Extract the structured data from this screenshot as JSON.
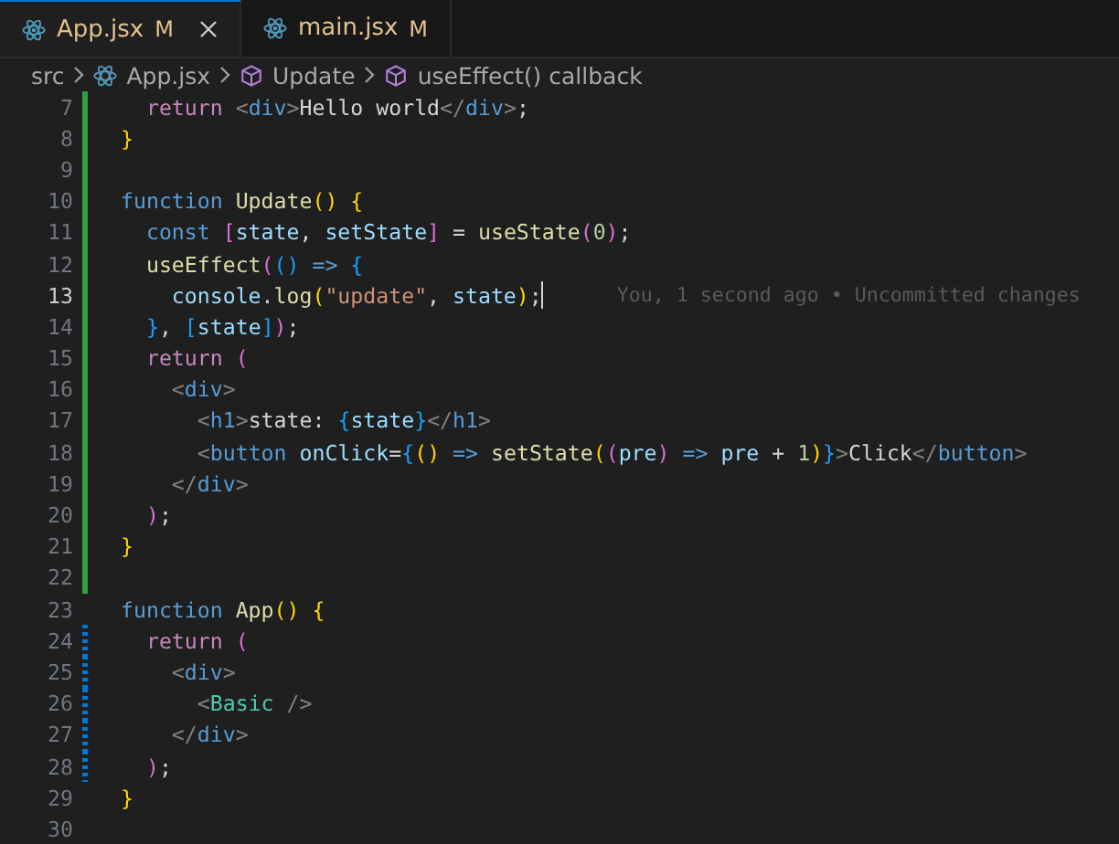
{
  "tabs": [
    {
      "label": "App.jsx",
      "status": "M",
      "selected": true
    },
    {
      "label": "main.jsx",
      "status": "M",
      "selected": false
    }
  ],
  "breadcrumb": [
    {
      "label": "src",
      "kind": "folder"
    },
    {
      "label": "App.jsx",
      "kind": "file"
    },
    {
      "label": "Update",
      "kind": "symbol"
    },
    {
      "label": "useEffect() callback",
      "kind": "symbol"
    }
  ],
  "editor": {
    "lines": [
      {
        "number": "7",
        "added": true,
        "modified": false,
        "current": false,
        "tokens": [
          {
            "t": "  return ",
            "color": "#c586c0"
          },
          {
            "t": "<",
            "color": "#808080"
          },
          {
            "t": "div",
            "color": "#569cd6"
          },
          {
            "t": ">",
            "color": "#808080"
          },
          {
            "t": "Hello world",
            "color": "#d4d4d4"
          },
          {
            "t": "</",
            "color": "#808080"
          },
          {
            "t": "div",
            "color": "#569cd6"
          },
          {
            "t": ">",
            "color": "#808080"
          },
          {
            "t": ";",
            "color": "#d4d4d4"
          }
        ]
      },
      {
        "number": "8",
        "added": true,
        "modified": false,
        "current": false,
        "tokens": [
          {
            "t": "}",
            "color": "#ffd700"
          }
        ]
      },
      {
        "number": "9",
        "added": true,
        "modified": false,
        "current": false
      },
      {
        "number": "10",
        "added": true,
        "modified": false,
        "current": false,
        "tokens": [
          {
            "t": "function ",
            "color": "#569cd6"
          },
          {
            "t": "Update",
            "color": "#dcdcaa"
          },
          {
            "t": "() {",
            "color": "#ffd700"
          }
        ]
      },
      {
        "number": "11",
        "added": true,
        "modified": false,
        "current": false,
        "tokens": [
          {
            "t": "  const ",
            "color": "#569cd6"
          },
          {
            "t": "[",
            "color": "#da70d6"
          },
          {
            "t": "state",
            "color": "#9cdcfe"
          },
          {
            "t": ", ",
            "color": "#d4d4d4"
          },
          {
            "t": "setState",
            "color": "#9cdcfe"
          },
          {
            "t": "] ",
            "color": "#da70d6"
          },
          {
            "t": "= ",
            "color": "#d4d4d4"
          },
          {
            "t": "useState",
            "color": "#dcdcaa"
          },
          {
            "t": "(",
            "color": "#da70d6"
          },
          {
            "t": "0",
            "color": "#b5cea8"
          },
          {
            "t": ")",
            "color": "#da70d6"
          },
          {
            "t": ";",
            "color": "#d4d4d4"
          }
        ]
      },
      {
        "number": "12",
        "added": true,
        "modified": false,
        "current": false,
        "tokens": [
          {
            "t": "  useEffect",
            "color": "#dcdcaa"
          },
          {
            "t": "(",
            "color": "#da70d6"
          },
          {
            "t": "() ",
            "color": "#179fff"
          },
          {
            "t": "=> ",
            "color": "#569cd6"
          },
          {
            "t": "{",
            "color": "#179fff"
          }
        ]
      },
      {
        "number": "13",
        "added": true,
        "modified": false,
        "current": true,
        "blame": "You, 1 second ago • Uncommitted changes",
        "tokens": [
          {
            "t": "    console",
            "color": "#9cdcfe"
          },
          {
            "t": ".",
            "color": "#d4d4d4"
          },
          {
            "t": "log",
            "color": "#dcdcaa"
          },
          {
            "t": "(",
            "color": "#ffd700"
          },
          {
            "t": "\"update\"",
            "color": "#ce9178"
          },
          {
            "t": ", ",
            "color": "#d4d4d4"
          },
          {
            "t": "state",
            "color": "#9cdcfe"
          },
          {
            "t": ")",
            "color": "#ffd700"
          },
          {
            "t": ";",
            "color": "#d4d4d4"
          }
        ]
      },
      {
        "number": "14",
        "added": true,
        "modified": false,
        "current": false,
        "tokens": [
          {
            "t": "  }",
            "color": "#179fff"
          },
          {
            "t": ", ",
            "color": "#d4d4d4"
          },
          {
            "t": "[",
            "color": "#179fff"
          },
          {
            "t": "state",
            "color": "#9cdcfe"
          },
          {
            "t": "]",
            "color": "#179fff"
          },
          {
            "t": ")",
            "color": "#da70d6"
          },
          {
            "t": ";",
            "color": "#d4d4d4"
          }
        ]
      },
      {
        "number": "15",
        "added": true,
        "modified": false,
        "current": false,
        "tokens": [
          {
            "t": "  return ",
            "color": "#c586c0"
          },
          {
            "t": "(",
            "color": "#da70d6"
          }
        ]
      },
      {
        "number": "16",
        "added": true,
        "modified": false,
        "current": false,
        "tokens": [
          {
            "t": "    <",
            "color": "#808080"
          },
          {
            "t": "div",
            "color": "#569cd6"
          },
          {
            "t": ">",
            "color": "#808080"
          }
        ]
      },
      {
        "number": "17",
        "added": true,
        "modified": false,
        "current": false,
        "tokens": [
          {
            "t": "      <",
            "color": "#808080"
          },
          {
            "t": "h1",
            "color": "#569cd6"
          },
          {
            "t": ">",
            "color": "#808080"
          },
          {
            "t": "state: ",
            "color": "#d4d4d4"
          },
          {
            "t": "{",
            "color": "#179fff"
          },
          {
            "t": "state",
            "color": "#9cdcfe"
          },
          {
            "t": "}",
            "color": "#179fff"
          },
          {
            "t": "</",
            "color": "#808080"
          },
          {
            "t": "h1",
            "color": "#569cd6"
          },
          {
            "t": ">",
            "color": "#808080"
          }
        ]
      },
      {
        "number": "18",
        "added": true,
        "modified": false,
        "current": false,
        "tokens": [
          {
            "t": "      <",
            "color": "#808080"
          },
          {
            "t": "button ",
            "color": "#569cd6"
          },
          {
            "t": "onClick",
            "color": "#9cdcfe"
          },
          {
            "t": "=",
            "color": "#d4d4d4"
          },
          {
            "t": "{",
            "color": "#179fff"
          },
          {
            "t": "() ",
            "color": "#ffd700"
          },
          {
            "t": "=> ",
            "color": "#569cd6"
          },
          {
            "t": "setState",
            "color": "#dcdcaa"
          },
          {
            "t": "(",
            "color": "#ffd700"
          },
          {
            "t": "(",
            "color": "#da70d6"
          },
          {
            "t": "pre",
            "color": "#9cdcfe"
          },
          {
            "t": ") ",
            "color": "#da70d6"
          },
          {
            "t": "=> ",
            "color": "#569cd6"
          },
          {
            "t": "pre ",
            "color": "#9cdcfe"
          },
          {
            "t": "+ ",
            "color": "#d4d4d4"
          },
          {
            "t": "1",
            "color": "#b5cea8"
          },
          {
            "t": ")",
            "color": "#ffd700"
          },
          {
            "t": "}",
            "color": "#179fff"
          },
          {
            "t": ">",
            "color": "#808080"
          },
          {
            "t": "Click",
            "color": "#d4d4d4"
          },
          {
            "t": "</",
            "color": "#808080"
          },
          {
            "t": "button",
            "color": "#569cd6"
          },
          {
            "t": ">",
            "color": "#808080"
          }
        ]
      },
      {
        "number": "19",
        "added": true,
        "modified": false,
        "current": false,
        "tokens": [
          {
            "t": "    </",
            "color": "#808080"
          },
          {
            "t": "div",
            "color": "#569cd6"
          },
          {
            "t": ">",
            "color": "#808080"
          }
        ]
      },
      {
        "number": "20",
        "added": true,
        "modified": false,
        "current": false,
        "tokens": [
          {
            "t": "  )",
            "color": "#da70d6"
          },
          {
            "t": ";",
            "color": "#d4d4d4"
          }
        ]
      },
      {
        "number": "21",
        "added": true,
        "modified": false,
        "current": false,
        "tokens": [
          {
            "t": "}",
            "color": "#ffd700"
          }
        ]
      },
      {
        "number": "22",
        "added": true,
        "modified": false,
        "current": false
      },
      {
        "number": "23",
        "added": false,
        "modified": false,
        "current": false,
        "tokens": [
          {
            "t": "function ",
            "color": "#569cd6"
          },
          {
            "t": "App",
            "color": "#dcdcaa"
          },
          {
            "t": "() {",
            "color": "#ffd700"
          }
        ]
      },
      {
        "number": "24",
        "added": false,
        "modified": true,
        "current": false,
        "tokens": [
          {
            "t": "  return ",
            "color": "#c586c0"
          },
          {
            "t": "(",
            "color": "#da70d6"
          }
        ]
      },
      {
        "number": "25",
        "added": false,
        "modified": true,
        "current": false,
        "tokens": [
          {
            "t": "    <",
            "color": "#808080"
          },
          {
            "t": "div",
            "color": "#569cd6"
          },
          {
            "t": ">",
            "color": "#808080"
          }
        ]
      },
      {
        "number": "26",
        "added": false,
        "modified": true,
        "current": false,
        "tokens": [
          {
            "t": "      <",
            "color": "#808080"
          },
          {
            "t": "Basic ",
            "color": "#4ec9b0"
          },
          {
            "t": "/>",
            "color": "#808080"
          }
        ]
      },
      {
        "number": "27",
        "added": false,
        "modified": true,
        "current": false,
        "tokens": [
          {
            "t": "    </",
            "color": "#808080"
          },
          {
            "t": "div",
            "color": "#569cd6"
          },
          {
            "t": ">",
            "color": "#808080"
          }
        ]
      },
      {
        "number": "28",
        "added": false,
        "modified": true,
        "current": false,
        "tokens": [
          {
            "t": "  )",
            "color": "#da70d6"
          },
          {
            "t": ";",
            "color": "#d4d4d4"
          }
        ]
      },
      {
        "number": "29",
        "added": false,
        "modified": false,
        "current": false,
        "tokens": [
          {
            "t": "}",
            "color": "#ffd700"
          }
        ]
      },
      {
        "number": "30",
        "added": false,
        "modified": false,
        "current": false
      }
    ]
  }
}
